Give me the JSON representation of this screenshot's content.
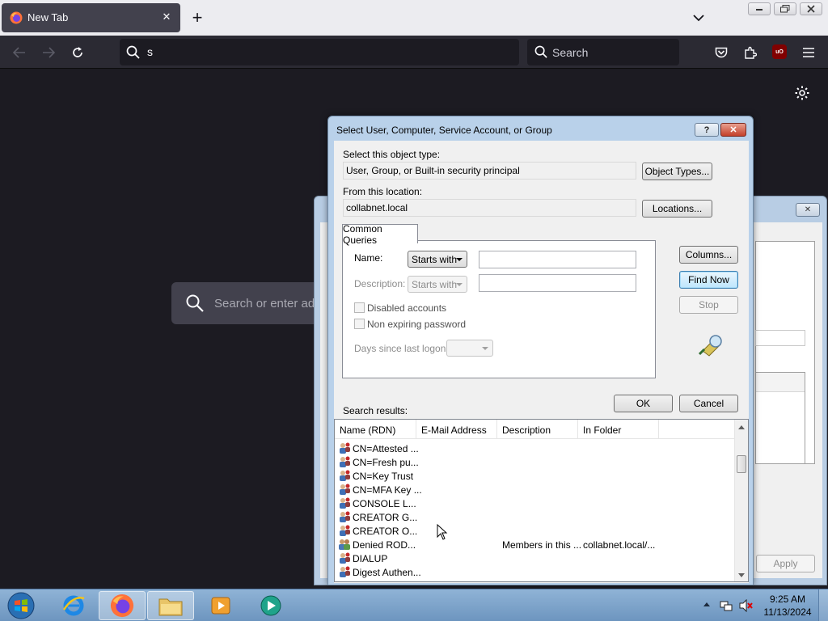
{
  "browser": {
    "tab_title": "New Tab",
    "url_value": "s",
    "search_placeholder": "Search",
    "home_search_placeholder": "Search or enter address",
    "ublock_label": "uO"
  },
  "dialog": {
    "title": "Select User, Computer, Service Account, or Group",
    "object_type_label": "Select this object type:",
    "object_type_value": "User, Group, or Built-in security principal",
    "object_types_button": "Object Types...",
    "location_label": "From this location:",
    "location_value": "collabnet.local",
    "locations_button": "Locations...",
    "tab_label": "Common Queries",
    "name_label": "Name:",
    "name_mode": "Starts with",
    "name_value": "",
    "description_label": "Description:",
    "description_mode": "Starts with",
    "disabled_accounts_label": "Disabled accounts",
    "non_expiring_label": "Non expiring password",
    "days_since_label": "Days since last logon:",
    "columns_button": "Columns...",
    "find_now_button": "Find Now",
    "stop_button": "Stop",
    "ok_button": "OK",
    "cancel_button": "Cancel",
    "search_results_label": "Search results:",
    "columns": [
      "Name (RDN)",
      "E-Mail Address",
      "Description",
      "In Folder"
    ],
    "rows": [
      {
        "name": "CN=Attested ...",
        "email": "",
        "description": "",
        "folder": "",
        "icon": "group-icon"
      },
      {
        "name": "CN=Fresh pu...",
        "email": "",
        "description": "",
        "folder": "",
        "icon": "group-icon"
      },
      {
        "name": "CN=Key Trust",
        "email": "",
        "description": "",
        "folder": "",
        "icon": "group-icon"
      },
      {
        "name": "CN=MFA Key ...",
        "email": "",
        "description": "",
        "folder": "",
        "icon": "group-icon"
      },
      {
        "name": "CONSOLE L...",
        "email": "",
        "description": "",
        "folder": "",
        "icon": "group-icon"
      },
      {
        "name": "CREATOR G...",
        "email": "",
        "description": "",
        "folder": "",
        "icon": "group-icon"
      },
      {
        "name": "CREATOR O...",
        "email": "",
        "description": "",
        "folder": "",
        "icon": "group-icon"
      },
      {
        "name": "Denied ROD...",
        "email": "",
        "description": "Members in this ...",
        "folder": "collabnet.local/...",
        "icon": "security-group-icon"
      },
      {
        "name": "DIALUP",
        "email": "",
        "description": "",
        "folder": "",
        "icon": "group-icon"
      },
      {
        "name": "Digest Authen...",
        "email": "",
        "description": "",
        "folder": "",
        "icon": "group-icon"
      }
    ]
  },
  "background_dialog": {
    "apply_button": "Apply"
  },
  "taskbar": {
    "time": "9:25 AM",
    "date": "11/13/2024"
  },
  "colors": {
    "browser_bg": "#1c1b22",
    "dialog_frame": "#b9d1ea",
    "default_button": "#bee6fd"
  }
}
